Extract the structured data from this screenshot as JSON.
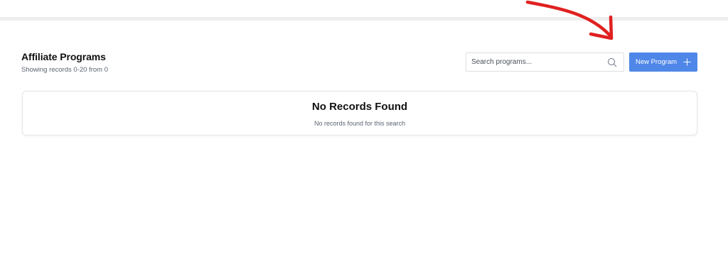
{
  "header": {
    "title": "Affiliate Programs",
    "subtitle": "Showing records 0-20 from 0"
  },
  "search": {
    "placeholder": "Search programs...",
    "value": "",
    "icon": "search-icon"
  },
  "toolbar": {
    "new_program_label": "New Program",
    "new_program_icon": "plus-icon",
    "accent_color": "#4f87e8"
  },
  "empty_state": {
    "title": "No Records Found",
    "message": "No records found for this search"
  },
  "annotation": {
    "color": "#e02020",
    "shape": "arrow-pointing-to-new-program-button"
  }
}
